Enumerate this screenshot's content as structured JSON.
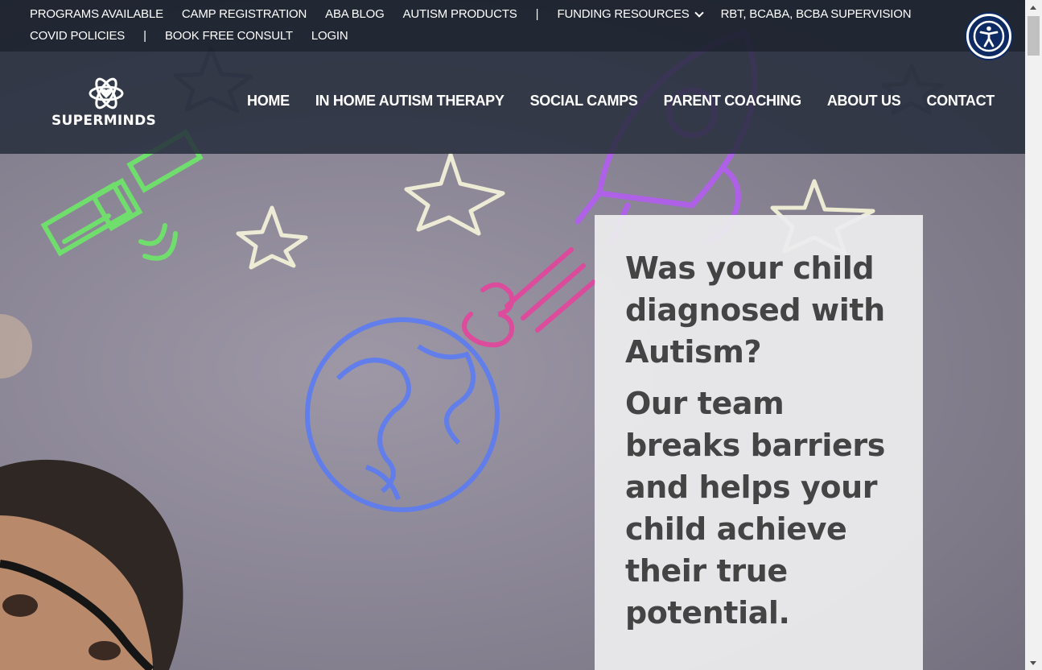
{
  "brand": {
    "name": "SUPERMINDS",
    "logo_icon": "atom-heart-icon"
  },
  "utility_nav": {
    "row1": [
      "PROGRAMS AVAILABLE",
      "CAMP REGISTRATION",
      "ABA BLOG",
      "AUTISM PRODUCTS",
      "|",
      "FUNDING RESOURCES",
      "RBT, BCABA, BCBA SUPERVISION"
    ],
    "row2": [
      "COVID POLICIES",
      "|",
      "BOOK FREE CONSULT",
      "LOGIN"
    ]
  },
  "main_nav": [
    "HOME",
    "IN HOME AUTISM THERAPY",
    "SOCIAL CAMPS",
    "PARENT COACHING",
    "ABOUT US",
    "CONTACT"
  ],
  "hero": {
    "headline": "Was your child diagnosed with Autism?",
    "subheadline": "Our team breaks barriers and helps your child achieve their true potential."
  },
  "accessibility": {
    "icon": "accessibility-person-icon"
  },
  "colors": {
    "topbar": "#1a202c",
    "mainbar": "#262d3c",
    "card_text": "#444444",
    "accessibility_bg": "#0d2a63"
  }
}
